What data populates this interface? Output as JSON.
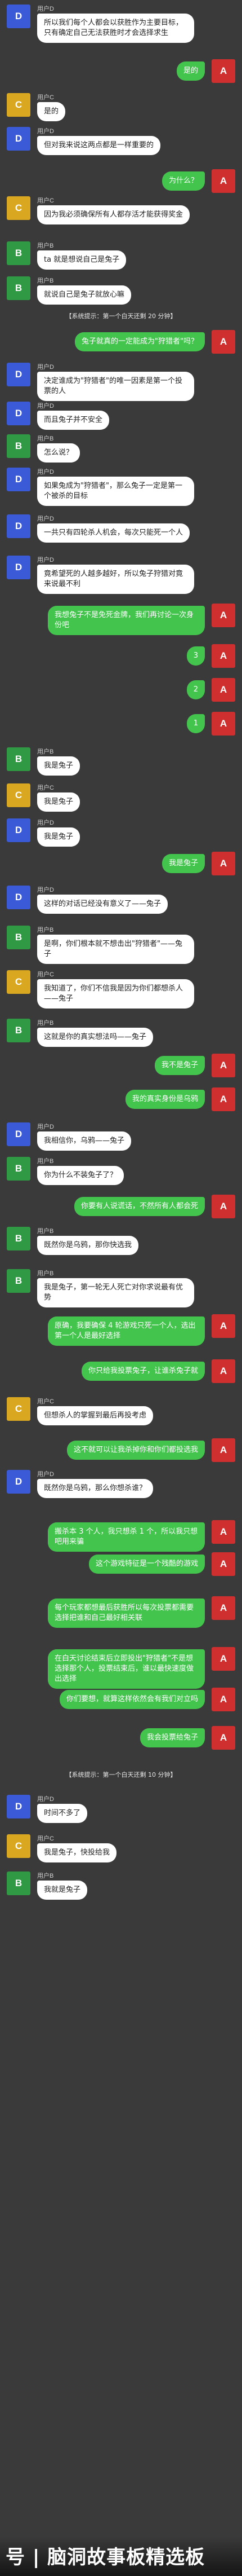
{
  "messages": [
    {
      "type": "msg",
      "side": "left",
      "avatar": "D",
      "name": "用户D",
      "text": "所以我们每个人都会以获胜作为主要目标，只有确定自己无法获胜时才会选择求生"
    },
    {
      "type": "msg",
      "side": "right",
      "avatar": "A",
      "text": "是的"
    },
    {
      "type": "msg",
      "side": "left",
      "avatar": "C",
      "name": "用户C",
      "text": "是的"
    },
    {
      "type": "msg",
      "side": "left",
      "avatar": "D",
      "name": "用户D",
      "text": "但对我来说这两点都是一样重要的"
    },
    {
      "type": "msg",
      "side": "right",
      "avatar": "A",
      "text": "为什么？"
    },
    {
      "type": "msg",
      "side": "left",
      "avatar": "C",
      "name": "用户C",
      "text": "因为我必须确保所有人都存活才能获得奖金"
    },
    {
      "type": "msg",
      "side": "left",
      "avatar": "B",
      "name": "用户B",
      "text": "ta 就是想说自己是兔子"
    },
    {
      "type": "msg",
      "side": "left",
      "avatar": "B",
      "name": "用户B",
      "text": "就说自己是兔子就放心嘛"
    },
    {
      "type": "sys",
      "text": "【系统提示：第一个白天还剩 20 分钟】"
    },
    {
      "type": "msg",
      "side": "right",
      "avatar": "A",
      "text": "兔子就真的一定能成为\"狩猎者\"吗？"
    },
    {
      "type": "msg",
      "side": "left",
      "avatar": "D",
      "name": "用户D",
      "text": "决定谁成为\"狩猎者\"的唯一因素是第一个投票的人"
    },
    {
      "type": "msg",
      "side": "left",
      "avatar": "D",
      "name": "用户D",
      "text": "而且兔子并不安全"
    },
    {
      "type": "msg",
      "side": "left",
      "avatar": "B",
      "name": "用户B",
      "text": "怎么说？"
    },
    {
      "type": "msg",
      "side": "left",
      "avatar": "D",
      "name": "用户D",
      "text": "如果兔成为\"狩猎者\"，那么兔子一定是第一个被杀的目标"
    },
    {
      "type": "msg",
      "side": "left",
      "avatar": "D",
      "name": "用户D",
      "text": "一共只有四轮杀人机会，每次只能死一个人"
    },
    {
      "type": "msg",
      "side": "left",
      "avatar": "D",
      "name": "用户D",
      "text": "竟希望死的人越多越好，所以兔子狩猎对竟来说最不利"
    },
    {
      "type": "msg",
      "side": "right",
      "avatar": "A",
      "text": "我想兔子不是免死金牌，我们再讨论一次身份吧"
    },
    {
      "type": "msg",
      "side": "right",
      "avatar": "A",
      "text": "3"
    },
    {
      "type": "msg",
      "side": "right",
      "avatar": "A",
      "text": "2"
    },
    {
      "type": "msg",
      "side": "right",
      "avatar": "A",
      "text": "1"
    },
    {
      "type": "msg",
      "side": "left",
      "avatar": "B",
      "name": "用户B",
      "text": "我是兔子"
    },
    {
      "type": "msg",
      "side": "left",
      "avatar": "C",
      "name": "用户C",
      "text": "我是兔子"
    },
    {
      "type": "msg",
      "side": "left",
      "avatar": "D",
      "name": "用户D",
      "text": "我是兔子"
    },
    {
      "type": "msg",
      "side": "right",
      "avatar": "A",
      "text": "我是兔子"
    },
    {
      "type": "msg",
      "side": "left",
      "avatar": "D",
      "name": "用户D",
      "text": "这样的对话已经没有意义了——兔子"
    },
    {
      "type": "msg",
      "side": "left",
      "avatar": "B",
      "name": "用户B",
      "text": "是啊，你们根本就不想击出\"狩猎者\"——兔子"
    },
    {
      "type": "msg",
      "side": "left",
      "avatar": "C",
      "name": "用户C",
      "text": "我知道了，你们不信我是因为你们都想杀人——兔子"
    },
    {
      "type": "msg",
      "side": "left",
      "avatar": "B",
      "name": "用户B",
      "text": "这就是你的真实想法吗——兔子"
    },
    {
      "type": "msg",
      "side": "right",
      "avatar": "A",
      "text": "我不是兔子"
    },
    {
      "type": "msg",
      "side": "right",
      "avatar": "A",
      "text": "我的真实身份是乌鸦"
    },
    {
      "type": "msg",
      "side": "left",
      "avatar": "D",
      "name": "用户D",
      "text": "我相信你，乌鸦——兔子"
    },
    {
      "type": "msg",
      "side": "left",
      "avatar": "B",
      "name": "用户B",
      "text": "你为什么不装兔子了？"
    },
    {
      "type": "msg",
      "side": "right",
      "avatar": "A",
      "text": "你要有人说谎话，不然所有人都会死"
    },
    {
      "type": "msg",
      "side": "left",
      "avatar": "B",
      "name": "用户B",
      "text": "既然你是乌鸦，那你快选我"
    },
    {
      "type": "msg",
      "side": "left",
      "avatar": "B",
      "name": "用户B",
      "text": "我是兔子，第一轮无人死亡对你求说最有优势"
    },
    {
      "type": "msg",
      "side": "right",
      "avatar": "A",
      "text": "原确，我要确保 4 轮游戏只死一个人，选出第一个人是最好选择"
    },
    {
      "type": "msg",
      "side": "right",
      "avatar": "A",
      "text": "你只给我投票兔子，让谁杀兔子就"
    },
    {
      "type": "msg",
      "side": "left",
      "avatar": "C",
      "name": "用户C",
      "text": "但想杀人的掌握到最后再投考虑"
    },
    {
      "type": "msg",
      "side": "right",
      "avatar": "A",
      "text": "这不就可以让我杀掉你和你们都投选我"
    },
    {
      "type": "msg",
      "side": "left",
      "avatar": "D",
      "name": "用户D",
      "text": "既然你是乌鸦，那么你想杀谁？"
    },
    {
      "type": "msg",
      "side": "right",
      "avatar": "A",
      "text": "搬杀本 3 个人，我只想杀 1 个，所以我只想吧用来骗"
    },
    {
      "type": "msg",
      "side": "right",
      "avatar": "A",
      "text": "这个游戏特征是一个残酷的游戏"
    },
    {
      "type": "msg",
      "side": "right",
      "avatar": "A",
      "text": "每个玩家都想最后获胜所以每次投票都需要选择把谁和自己最好相关联"
    },
    {
      "type": "msg",
      "side": "right",
      "avatar": "A",
      "text": "在白天讨论结束后立即投出\"狩猎者\"不是想选择那个人，投票结束后，谁以最快速度做出选择"
    },
    {
      "type": "msg",
      "side": "right",
      "avatar": "A",
      "text": "你们要想，就算这样依然会有我们对立吗"
    },
    {
      "type": "msg",
      "side": "right",
      "avatar": "A",
      "text": "我会投票给兔子"
    },
    {
      "type": "sys",
      "text": "【系统提示：第一个白天还剩 10 分钟】"
    },
    {
      "type": "msg",
      "side": "left",
      "avatar": "D",
      "name": "用户D",
      "text": "时间不多了"
    },
    {
      "type": "msg",
      "side": "left",
      "avatar": "C",
      "name": "用户C",
      "text": "我是兔子，快投给我"
    },
    {
      "type": "msg",
      "side": "left",
      "avatar": "B",
      "name": "用户B",
      "text": "我就是兔子"
    }
  ],
  "watermark": "号 | 脑洞故事板精选板",
  "colors": {
    "A": "#d02f2f",
    "B": "#2f9a43",
    "C": "#d9a720",
    "D": "#3b5ad8",
    "bubble_self": "#43c44d",
    "bubble_other": "#ffffff",
    "background": "#3a3a3a"
  }
}
